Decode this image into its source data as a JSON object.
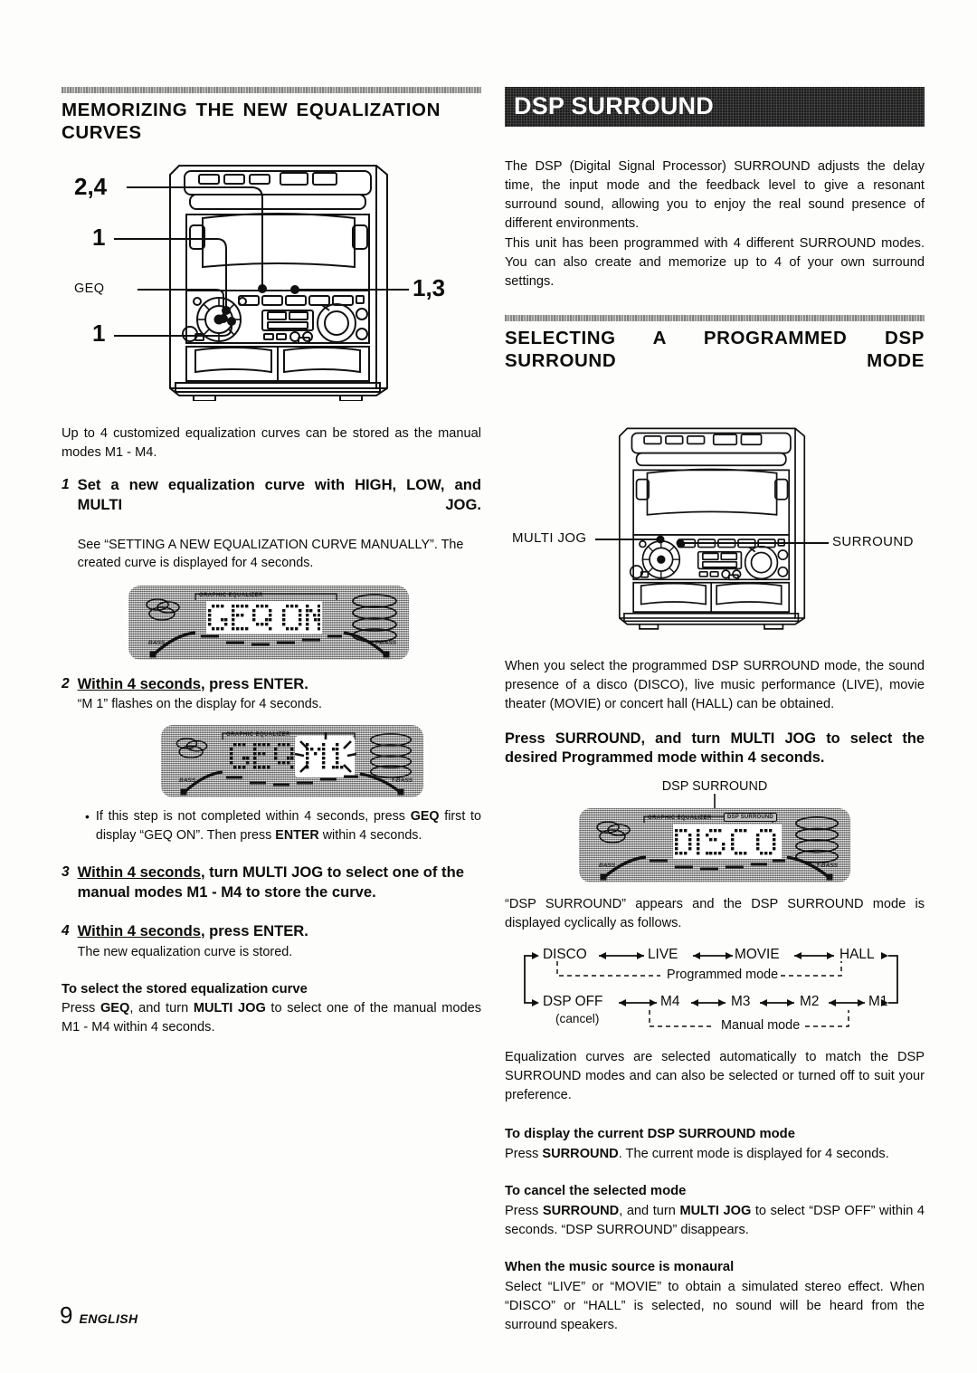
{
  "page": {
    "number": "9",
    "language": "ENGLISH"
  },
  "left": {
    "heading": "MEMORIZING THE NEW EQUALIZATION CURVES",
    "diagram": {
      "callouts": {
        "top": "2,4",
        "upper_left": "1",
        "geq": "GEQ",
        "lower_left": "1",
        "right": "1,3"
      }
    },
    "intro": "Up to 4 customized equalization curves can be stored as the manual modes M1 -  M4.",
    "steps": [
      {
        "num": "1",
        "title": "Set a new equalization curve with HIGH, LOW, and MULTI JOG.",
        "underline": "",
        "sub": "See “SETTING A NEW EQUALIZATION CURVE MANUALLY”. The created curve is displayed for 4 seconds."
      },
      {
        "num": "2",
        "title_underlined": "Within 4 seconds",
        "title_rest": ",  press ENTER.",
        "sub": "“M 1” flashes on the display for 4 seconds."
      },
      {
        "num": "3",
        "title_underlined": "Within 4 seconds",
        "title_rest": ", turn MULTI JOG to select one of the manual modes M1 -  M4 to store the curve.",
        "sub": ""
      },
      {
        "num": "4",
        "title_underlined": "Within 4 seconds",
        "title_rest": ", press ENTER.",
        "sub": "The new  equalization curve is stored."
      }
    ],
    "bullet": {
      "dot": "•",
      "text_1": "If this step is not completed within 4 seconds, press ",
      "bold_1": "GEQ",
      "text_2": " first to display “GEQ ON”. Then press ",
      "bold_2": "ENTER",
      "text_3": " within 4 seconds."
    },
    "display_1": {
      "text": "GEQ ON",
      "eq_label": "GRAPHIC EQUALIZER",
      "low_label": "BASS",
      "high_label": "T-BASS"
    },
    "display_2": {
      "text": "GEQ M1",
      "flashing": "M1",
      "eq_label": "GRAPHIC EQUALIZER",
      "low_label": "BASS",
      "high_label": "T-BASS"
    },
    "select_stored": {
      "heading": "To select the stored  equalization curve",
      "text_1": "Press ",
      "bold_1": "GEQ",
      "text_2": ",  and turn ",
      "bold_2": "MULTI JOG",
      "text_3": " to select one of the manual modes M1 -  M4 within 4 seconds."
    }
  },
  "right": {
    "banner": "DSP SURROUND",
    "intro_p1": "The DSP (Digital Signal Processor) SURROUND adjusts the delay time, the input mode and the feedback level to give a resonant surround sound, allowing you to enjoy the real sound presence of different environments.",
    "intro_p2": "This unit has been programmed with 4 different SURROUND modes.  You can also create and memorize up to 4 of your own surround settings.",
    "heading": "SELECTING A PROGRAMMED DSP SURROUND MODE",
    "diagram": {
      "callout_left": "MULTI JOG",
      "callout_right": "SURROUND"
    },
    "para_modes": "When you select the programmed DSP SURROUND mode, the sound presence of a disco (DISCO), live music performance (LIVE), movie theater (MOVIE) or concert hall (HALL) can be obtained.",
    "press_instruction": "Press SURROUND, and turn MULTI JOG to select the desired Programmed mode within 4 seconds.",
    "display_caption": "DSP SURROUND",
    "display_3": {
      "text": "DISCO",
      "eq_label": "GRAPHIC EQUALIZER",
      "badge": "DSP SURROUND",
      "low_label": "BASS",
      "high_label": "T-BASS"
    },
    "cycle_text": "“DSP SURROUND” appears and the DSP SURROUND mode is displayed cyclically as follows.",
    "flow": {
      "programmed": [
        "DISCO",
        "LIVE",
        "MOVIE",
        "HALL"
      ],
      "manual": [
        "DSP OFF",
        "M4",
        "M3",
        "M2",
        "M1"
      ],
      "cancel_note": "(cancel)",
      "label_programmed": "Programmed mode",
      "label_manual": "Manual mode"
    },
    "para_curves": "Equalization curves are selected automatically to match the DSP SURROUND modes and can also be selected or turned off to suit your preference.",
    "sections": [
      {
        "heading": "To display the current DSP SURROUND mode",
        "text_1": "Press ",
        "bold_1": "SURROUND",
        "text_2": ". The current mode is displayed for 4 seconds.",
        "bold_2": "",
        "text_3": ""
      },
      {
        "heading": "To cancel the selected mode",
        "text_1": "Press ",
        "bold_1": "SURROUND",
        "text_2": ", and turn ",
        "bold_2": "MULTI JOG",
        "text_3": " to select “DSP OFF” within 4 seconds. “DSP SURROUND” disappears."
      },
      {
        "heading": "When the music source is monaural",
        "text_1": "Select “LIVE” or “MOVIE” to obtain a simulated stereo effect. When “DISCO” or “HALL” is selected, no sound will be heard from the surround speakers.",
        "bold_1": "",
        "text_2": "",
        "bold_2": "",
        "text_3": ""
      }
    ]
  }
}
